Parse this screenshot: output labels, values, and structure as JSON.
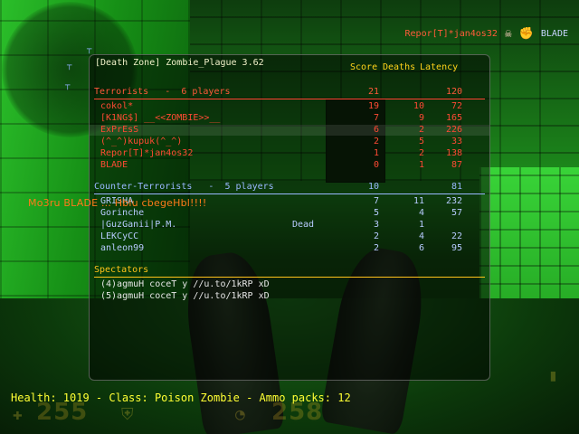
{
  "killfeed": {
    "killer": "Repor[T]*jan4os32",
    "victim": "BLADE"
  },
  "scoreboard": {
    "title": "[Death Zone] Zombie_Plague 3.62",
    "columns": {
      "score": "Score",
      "deaths": "Deaths",
      "latency": "Latency"
    },
    "terrorists": {
      "label": "Terrorists   -  6 players",
      "score": "21",
      "latency": "120",
      "players": [
        {
          "name": "cokol*",
          "score": "19",
          "deaths": "10",
          "latency": "72"
        },
        {
          "name": "[K1NG$] __<<ZOMBIE>>__",
          "score": "7",
          "deaths": "9",
          "latency": "165"
        },
        {
          "name": "ExPrEsS",
          "score": "6",
          "deaths": "2",
          "latency": "226"
        },
        {
          "name": "(^_^)kupuk(^_^)",
          "score": "2",
          "deaths": "5",
          "latency": "33"
        },
        {
          "name": "Repor[T]*jan4os32",
          "score": "1",
          "deaths": "2",
          "latency": "138"
        },
        {
          "name": "BLADE",
          "score": "0",
          "deaths": "1",
          "latency": "87"
        }
      ]
    },
    "counter_terrorists": {
      "label": "Counter-Terrorists   -  5 players",
      "score": "10",
      "latency": "81",
      "players": [
        {
          "name": "GRISHA",
          "status": "",
          "score": "7",
          "deaths": "11",
          "latency": "232"
        },
        {
          "name": "Gorinche",
          "status": "",
          "score": "5",
          "deaths": "4",
          "latency": "57"
        },
        {
          "name": "|GuzGanii|P.M.",
          "status": "Dead",
          "score": "3",
          "deaths": "1",
          "latency": ""
        },
        {
          "name": "LEKCyCC",
          "status": "",
          "score": "2",
          "deaths": "4",
          "latency": "22"
        },
        {
          "name": "anleon99",
          "status": "",
          "score": "2",
          "deaths": "6",
          "latency": "95"
        }
      ]
    },
    "spectators": {
      "label": "Spectators",
      "players": [
        "(4)agmuH coceT y //u.to/1kRP xD",
        "(5)agmuH coceT y //u.to/1kRP xD"
      ]
    }
  },
  "chat": "Mo3ru BLADE ... Hblu cbegeHbl!!!!",
  "status_line": "Health: 1019 - Class: Poison Zombie - Ammo packs: 12",
  "hud": {
    "health": "255",
    "armor": "258",
    "health_icon": "plus-icon",
    "armor_icon": "shield-icon"
  },
  "colors": {
    "terrorist": "#ff4a34",
    "counter_terrorist": "#b8cbff",
    "header": "#ffd21a",
    "status": "#ffff33"
  }
}
